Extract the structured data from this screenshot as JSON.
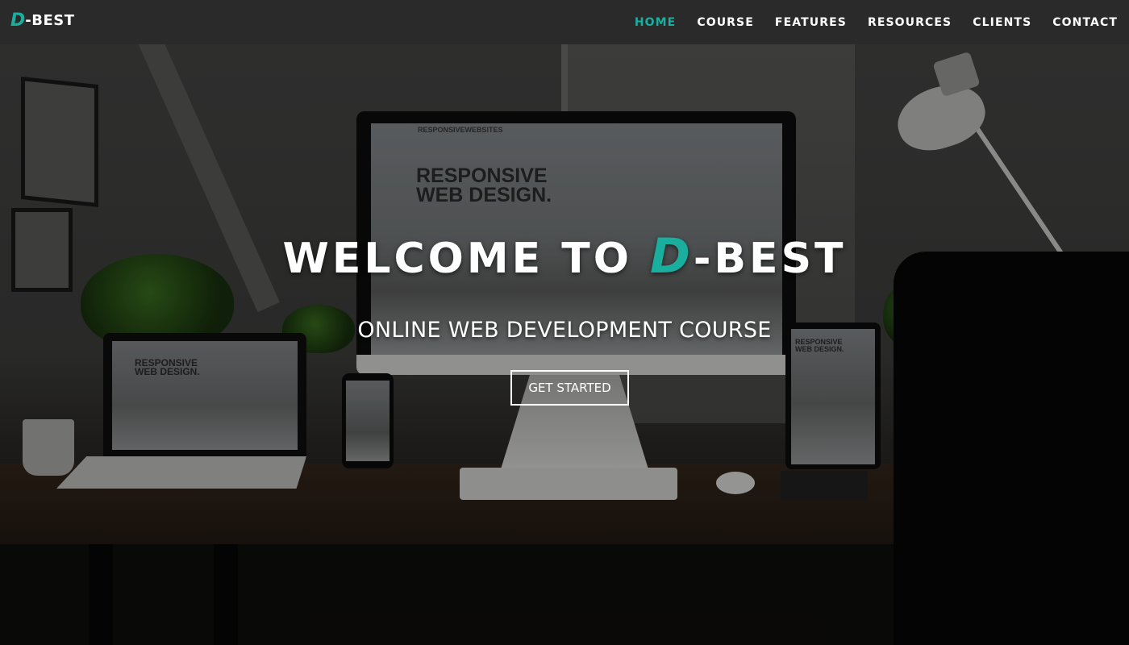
{
  "brand": {
    "logo_mark": "D",
    "logo_text": "-BEST"
  },
  "nav": {
    "items": [
      {
        "label": "HOME",
        "active": true
      },
      {
        "label": "COURSE",
        "active": false
      },
      {
        "label": "FEATURES",
        "active": false
      },
      {
        "label": "RESOURCES",
        "active": false
      },
      {
        "label": "CLIENTS",
        "active": false
      },
      {
        "label": "CONTACT",
        "active": false
      }
    ]
  },
  "hero": {
    "title_prefix": "WELCOME TO ",
    "title_mark": "D",
    "title_suffix": "-BEST",
    "subtitle": "ONLINE WEB DEVELOPMENT COURSE",
    "cta_label": "GET STARTED"
  },
  "background_mockups": {
    "imac_brand": "RESPONSIVEWEBSITES",
    "imac_headline": "RESPONSIVE WEB DESIGN.",
    "laptop_headline": "RESPONSIVE WEB DESIGN.",
    "tablet_headline": "RESPONSIVE WEB DESIGN."
  },
  "colors": {
    "accent": "#1aae9f",
    "navbar": "#2a2a2a",
    "text": "#ffffff"
  }
}
